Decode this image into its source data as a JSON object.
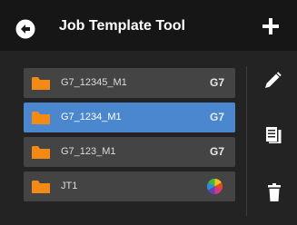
{
  "header": {
    "title": "Job Template Tool",
    "back_icon": "back-arrow-circle-icon",
    "add_icon": "plus-icon"
  },
  "templates": [
    {
      "name": "G7_12345_M1",
      "badge": "G7",
      "selected": false,
      "icon": "folder-icon"
    },
    {
      "name": "G7_1234_M1",
      "badge": "G7",
      "selected": true,
      "icon": "folder-icon"
    },
    {
      "name": "G7_123_M1",
      "badge": "G7",
      "selected": false,
      "icon": "folder-icon"
    },
    {
      "name": "JT1",
      "badge": "",
      "badge_icon": "color-wheel-icon",
      "selected": false,
      "icon": "folder-icon"
    }
  ],
  "side_actions": [
    {
      "icon": "pencil-icon"
    },
    {
      "icon": "copy-document-icon"
    },
    {
      "icon": "trash-icon"
    }
  ],
  "colors": {
    "header_bg": "#161616",
    "body_bg": "#232323",
    "row_bg": "#444444",
    "row_selected_bg": "#4b87cf",
    "folder_orange": "#f28a14"
  }
}
